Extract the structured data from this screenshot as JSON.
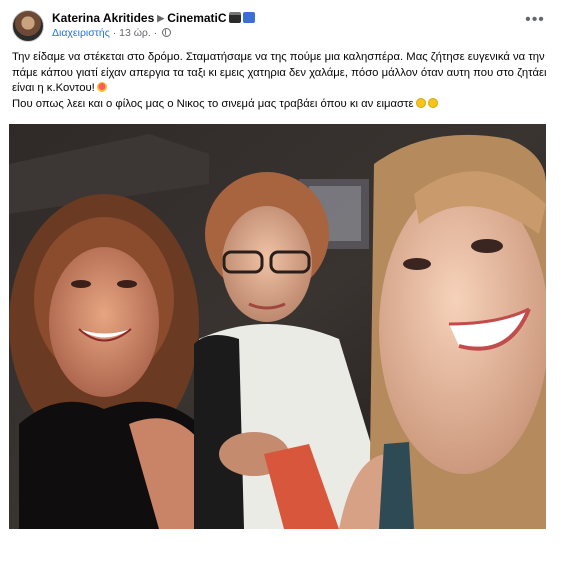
{
  "post": {
    "author": "Katerina Akritides",
    "page": "CinematiC",
    "role": "Διαχειριστής",
    "time": "13 ώρ.",
    "more_label": "•••",
    "caption_line1": "Την είδαμε να στέκεται στο δρόμο. Σταματήσαμε να της πούμε μια καλησπέρα. Μας ζήτησε ευγενικά να την πάμε κάπου γιατί είχαν απεργια τα ταξι κι εμεις χατηρια δεν χαλάμε, πόσο μάλλον όταν αυτη που στο ζητάει είναι η κ.Κοντου!",
    "caption_line2": "Που οπως λεει και ο φίλος μας ο Νικος το σινεμά μας τραβάει όπου κι αν ειμαστε"
  },
  "icons": {
    "arrow": "triangle-right-icon",
    "badges": [
      "clapperboard-icon",
      "picture-frame-icon"
    ],
    "privacy": "globe-icon",
    "emojis": [
      "heart-eyes-emoji",
      "grin-emoji",
      "smile-emoji"
    ]
  },
  "colors": {
    "link_blue": "#1b74e4",
    "secondary_text": "#65676b"
  }
}
